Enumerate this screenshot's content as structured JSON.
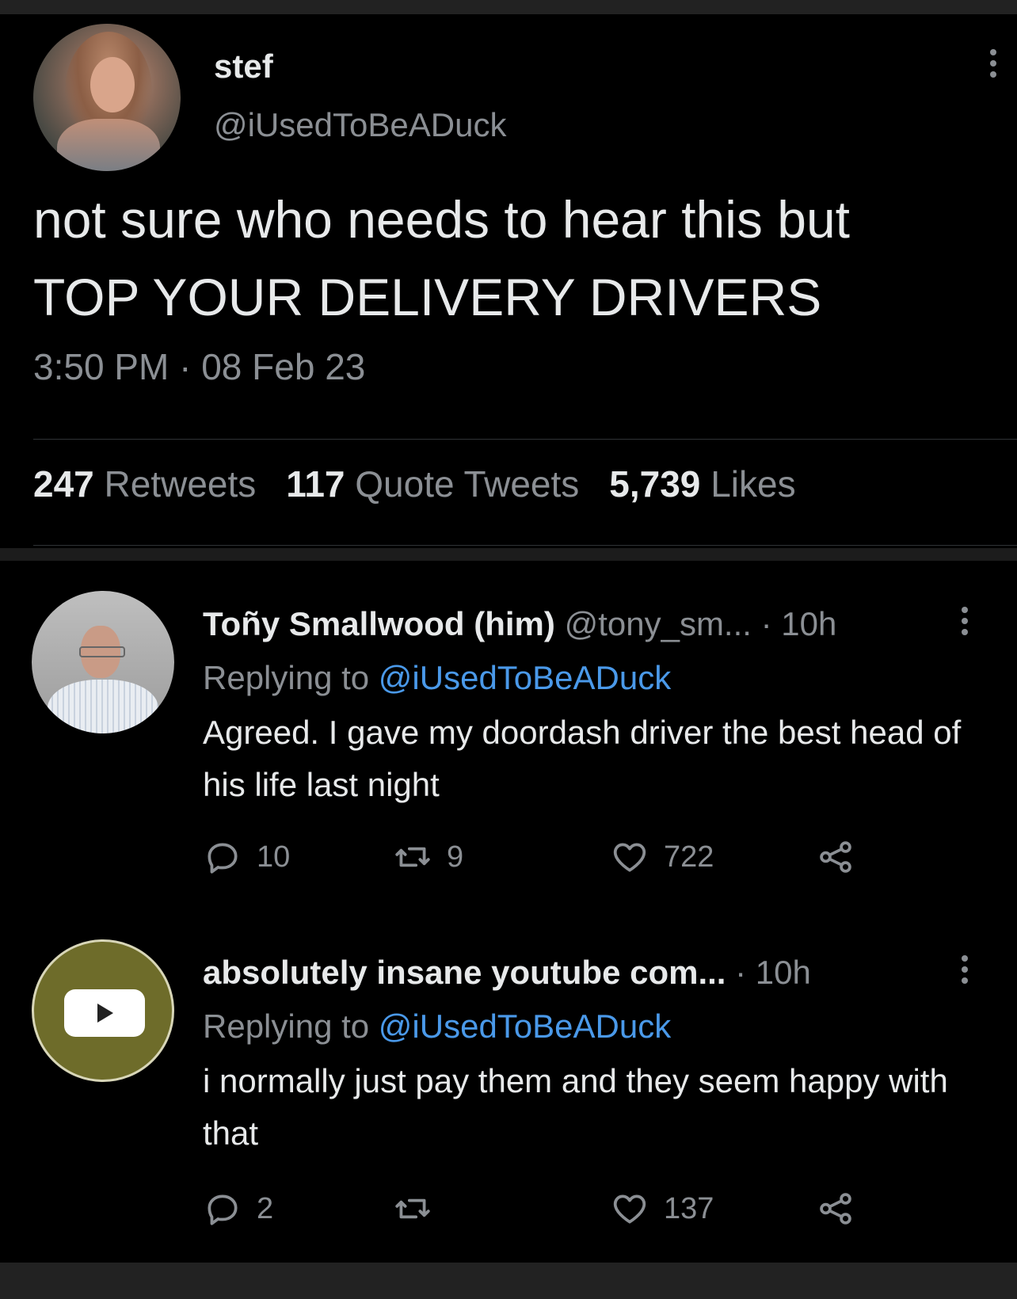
{
  "main_tweet": {
    "display_name": "stef",
    "handle": "@iUsedToBeADuck",
    "text_line1": "not sure who needs to hear this but",
    "text_line2": "TOP YOUR DELIVERY DRIVERS",
    "time": "3:50 PM",
    "separator": "·",
    "date": "08 Feb 23",
    "stats": {
      "retweets_count": "247",
      "retweets_label": "Retweets",
      "quotes_count": "117",
      "quotes_label": "Quote Tweets",
      "likes_count": "5,739",
      "likes_label": "Likes"
    }
  },
  "replies": [
    {
      "display_name": "Toñy Smallwood (him)",
      "handle": "@tony_sm...",
      "age": "· 10h",
      "replying_prefix": "Replying to",
      "replying_to": "@iUsedToBeADuck",
      "text": "Agreed. I gave my doordash driver the best head of his life last night",
      "reply_count": "10",
      "retweet_count": "9",
      "like_count": "722"
    },
    {
      "display_name": "absolutely insane youtube com...",
      "age": "· 10h",
      "replying_prefix": "Replying to",
      "replying_to": "@iUsedToBeADuck",
      "text": "i normally just pay them and they seem happy with that",
      "reply_count": "2",
      "retweet_count": "",
      "like_count": "137"
    }
  ],
  "icons": [
    "more-vert-icon",
    "reply-icon",
    "retweet-icon",
    "like-icon",
    "share-icon",
    "youtube-play-icon"
  ],
  "colors": {
    "background": "#000000",
    "text": "#e7e9ea",
    "secondary_text": "#8b8f94",
    "link": "#4a99e9",
    "divider": "#2f3336"
  }
}
